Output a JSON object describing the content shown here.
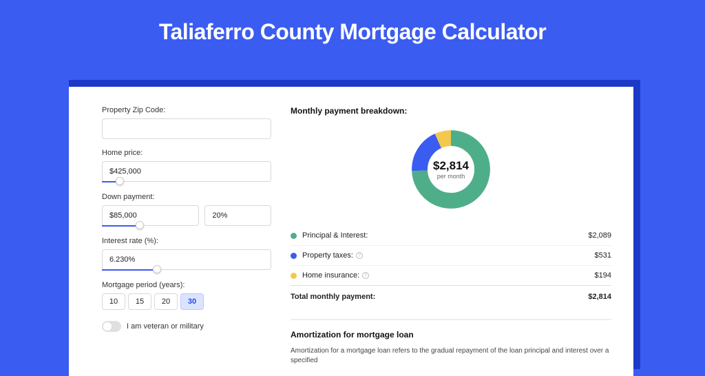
{
  "hero": {
    "title": "Taliaferro County Mortgage Calculator"
  },
  "form": {
    "zip_label": "Property Zip Code:",
    "zip_value": "",
    "price_label": "Home price:",
    "price_value": "$425,000",
    "price_slider_pct": 8,
    "down_label": "Down payment:",
    "down_value": "$85,000",
    "down_pct_value": "20%",
    "down_slider_pct": 20,
    "rate_label": "Interest rate (%):",
    "rate_value": "6.230%",
    "rate_slider_pct": 30,
    "period_label": "Mortgage period (years):",
    "period_options": [
      "10",
      "15",
      "20",
      "30"
    ],
    "period_selected": "30",
    "veteran_label": "I am veteran or military"
  },
  "breakdown": {
    "title": "Monthly payment breakdown:",
    "center_amount": "$2,814",
    "center_sub": "per month",
    "items": [
      {
        "label": "Principal & Interest:",
        "value": "$2,089",
        "color": "#4fae8a",
        "has_info": false
      },
      {
        "label": "Property taxes:",
        "value": "$531",
        "color": "#3b5cf0",
        "has_info": true
      },
      {
        "label": "Home insurance:",
        "value": "$194",
        "color": "#f2c94c",
        "has_info": true
      }
    ],
    "total_label": "Total monthly payment:",
    "total_value": "$2,814"
  },
  "amort": {
    "title": "Amortization for mortgage loan",
    "text": "Amortization for a mortgage loan refers to the gradual repayment of the loan principal and interest over a specified"
  },
  "chart_data": {
    "type": "pie",
    "title": "Monthly payment breakdown",
    "series": [
      {
        "name": "Principal & Interest",
        "value": 2089,
        "color": "#4fae8a"
      },
      {
        "name": "Property taxes",
        "value": 531,
        "color": "#3b5cf0"
      },
      {
        "name": "Home insurance",
        "value": 194,
        "color": "#f2c94c"
      }
    ],
    "total": 2814,
    "unit": "USD per month"
  }
}
